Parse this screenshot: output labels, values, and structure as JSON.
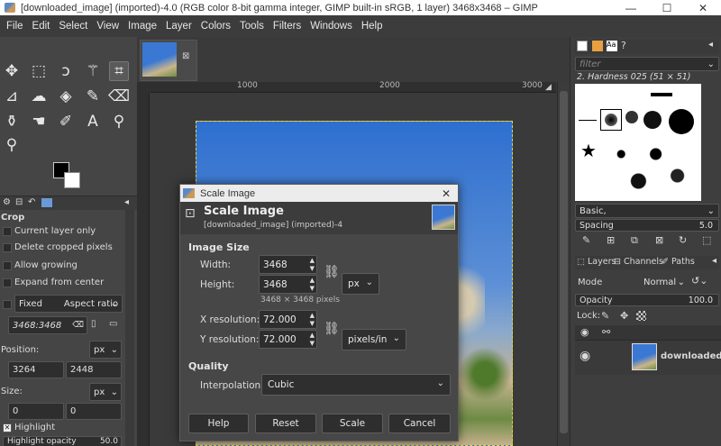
{
  "window": {
    "title": "[downloaded_image] (imported)-4.0 (RGB color 8-bit gamma integer, GIMP built-in sRGB, 1 layer) 3468x3468 – GIMP",
    "min": "—",
    "max": "☐",
    "close": "✕"
  },
  "menu": [
    "File",
    "Edit",
    "Select",
    "View",
    "Image",
    "Layer",
    "Colors",
    "Tools",
    "Filters",
    "Windows",
    "Help"
  ],
  "tool_options": {
    "title": "Crop",
    "current_layer_only": "Current layer only",
    "delete_cropped": "Delete cropped pixels",
    "allow_growing": "Allow growing",
    "expand_from_center": "Expand from center",
    "fixed": "Fixed",
    "aspect_ratio": "Aspect ratio",
    "ratio_value": "3468:3468",
    "position_label": "Position:",
    "position_unit": "px",
    "position_x": "3264",
    "position_y": "2448",
    "size_label": "Size:",
    "size_unit": "px",
    "size_w": "0",
    "size_h": "0",
    "highlight": "Highlight",
    "highlight_opacity": "Highlight opacity",
    "highlight_opacity_value": "50.0"
  },
  "rulers": {
    "r1000": "1000",
    "r2000": "2000",
    "r3000": "3000"
  },
  "brushes": {
    "filter_placeholder": "filter",
    "current": "2. Hardness 025 (51 × 51)",
    "preset": "Basic,",
    "spacing_label": "Spacing",
    "spacing_value": "5.0"
  },
  "layers": {
    "tab_layers": "Layers",
    "tab_channels": "Channels",
    "tab_paths": "Paths",
    "mode_label": "Mode",
    "mode_value": "Normal",
    "opacity_label": "Opacity",
    "opacity_value": "100.0",
    "lock_label": "Lock:",
    "layer_name": "downloaded_i"
  },
  "dialog": {
    "window_title": "Scale Image",
    "header_title": "Scale Image",
    "header_sub": "[downloaded_image] (imported)-4",
    "image_size": "Image Size",
    "width_label": "Width:",
    "width_value": "3468",
    "height_label": "Height:",
    "height_value": "3468",
    "unit": "px",
    "size_info": "3468 × 3468 pixels",
    "xres_label": "X resolution:",
    "xres_value": "72.000",
    "yres_label": "Y resolution:",
    "yres_value": "72.000",
    "res_unit": "pixels/in",
    "quality": "Quality",
    "interp_label": "Interpolation:",
    "interp_value": "Cubic",
    "help": "Help",
    "reset": "Reset",
    "scale": "Scale",
    "cancel": "Cancel"
  }
}
